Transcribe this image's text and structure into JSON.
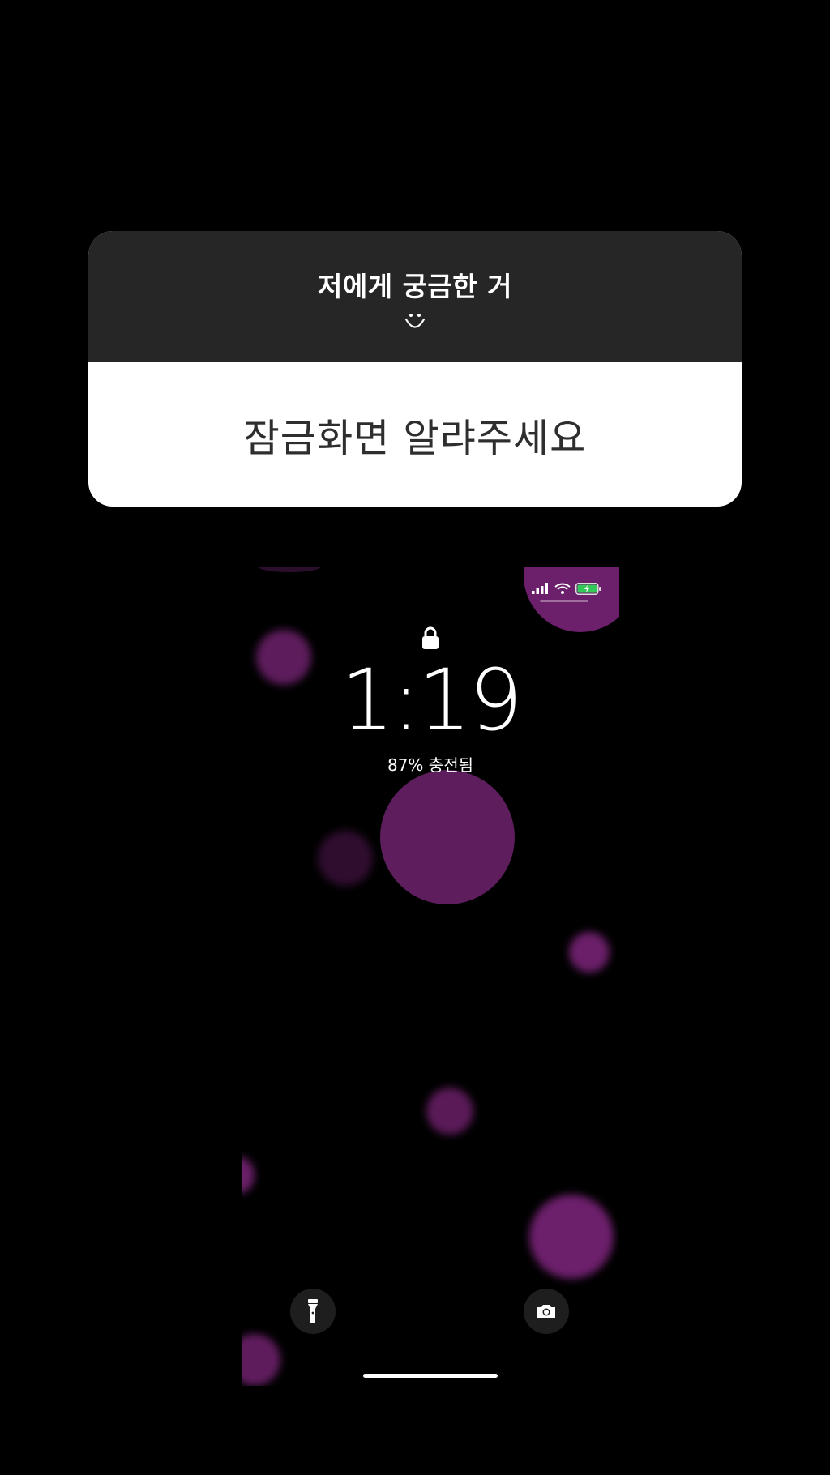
{
  "question_card": {
    "title": "저에게 궁금한 거",
    "emoji_icon": "smile-icon",
    "answer": "잠금화면 알랴주세요"
  },
  "lock_screen": {
    "time": "1:19",
    "charging_status": "87% 충전됨",
    "status_icons": [
      "cellular-signal-icon",
      "wifi-icon",
      "battery-charging-icon"
    ],
    "buttons": [
      "flashlight-icon",
      "camera-icon"
    ],
    "accent_color": "#6c1f6b"
  }
}
